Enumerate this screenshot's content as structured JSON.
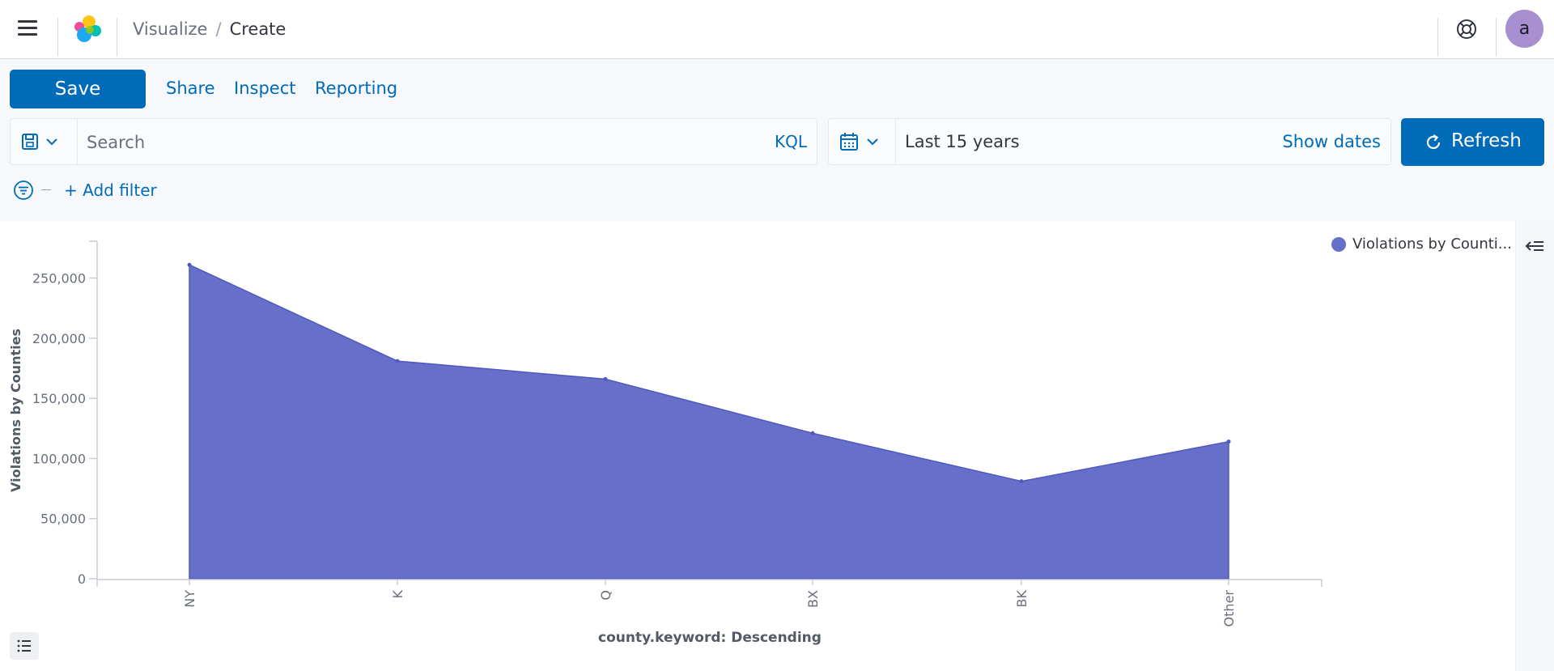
{
  "header": {
    "breadcrumb_parent": "Visualize",
    "breadcrumb_separator": "/",
    "breadcrumb_current": "Create",
    "avatar_initial": "a",
    "icons": [
      "menu-icon",
      "elastic-logo",
      "help-icon"
    ]
  },
  "toolbar": {
    "save_label": "Save",
    "share_label": "Share",
    "inspect_label": "Inspect",
    "reporting_label": "Reporting"
  },
  "query": {
    "search_placeholder": "Search",
    "search_value": "",
    "language_label": "KQL"
  },
  "time": {
    "range_label": "Last 15 years",
    "show_dates_label": "Show dates",
    "refresh_label": "Refresh"
  },
  "filters": {
    "add_filter_label": "+ Add filter"
  },
  "chart_data": {
    "type": "area",
    "categories": [
      "NY",
      "K",
      "Q",
      "BX",
      "BK",
      "Other"
    ],
    "series": [
      {
        "name": "Violations by Counti...",
        "values": [
          261000,
          181000,
          166000,
          121000,
          81000,
          114000
        ]
      }
    ],
    "xlabel": "county.keyword: Descending",
    "ylabel": "Violations by Counties",
    "ylim": [
      0,
      280000
    ],
    "yticks": [
      0,
      50000,
      100000,
      150000,
      200000,
      250000
    ],
    "ytick_labels": [
      "0",
      "50,000",
      "100,000",
      "150,000",
      "200,000",
      "250,000"
    ],
    "legend_position": "top-right",
    "grid": false,
    "colors": {
      "area_fill": "#6770c8",
      "area_stroke": "#4f58c0"
    }
  },
  "colors": {
    "primary": "#006bb8",
    "avatar": "#a88fd1",
    "app_background": "#f7f8fc"
  }
}
